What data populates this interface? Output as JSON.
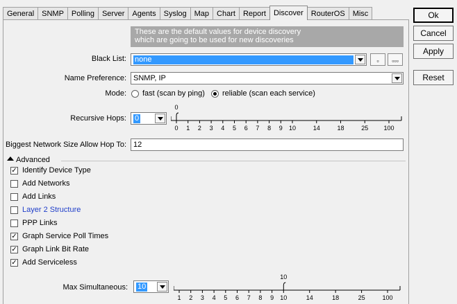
{
  "tabs": [
    "General",
    "SNMP",
    "Polling",
    "Server",
    "Agents",
    "Syslog",
    "Map",
    "Chart",
    "Report",
    "Discover",
    "RouterOS",
    "Misc"
  ],
  "active_tab": "Discover",
  "info": {
    "line1": "These are the default values for device discovery",
    "line2": "which are going to be used for new discoveries"
  },
  "black_list": {
    "label": "Black List:",
    "value": "none",
    "btn1": "▫",
    "btn2": "▫▫▫"
  },
  "name_pref": {
    "label": "Name Preference:",
    "value": "SNMP, IP"
  },
  "mode": {
    "label": "Mode:",
    "options": [
      "fast (scan by ping)",
      "reliable (scan each service)"
    ],
    "selected": "reliable (scan each service)"
  },
  "recursive_hops": {
    "label": "Recursive Hops:",
    "value": "0",
    "slider_value_label": "0",
    "ticks": [
      "0",
      "1",
      "2",
      "3",
      "4",
      "5",
      "6",
      "7",
      "8",
      "9",
      "10",
      "14",
      "18",
      "25",
      "100"
    ],
    "slider_index": 0
  },
  "biggest": {
    "label": "Biggest Network Size Allow Hop To:",
    "value": "12"
  },
  "advanced": {
    "label": "Advanced",
    "items": [
      {
        "label": "Identify Device Type",
        "checked": true
      },
      {
        "label": "Add Networks",
        "checked": false
      },
      {
        "label": "Add Links",
        "checked": false
      },
      {
        "label": "Layer 2 Structure",
        "checked": false,
        "color": "#1f3ec9"
      },
      {
        "label": "PPP Links",
        "checked": false
      },
      {
        "label": "Graph Service Poll Times",
        "checked": true
      },
      {
        "label": "Graph Link Bit Rate",
        "checked": true
      },
      {
        "label": "Add Serviceless",
        "checked": true
      }
    ]
  },
  "max_sim": {
    "label": "Max Simultaneous:",
    "value": "10",
    "slider_value_label": "10",
    "ticks": [
      "1",
      "2",
      "3",
      "4",
      "5",
      "6",
      "7",
      "8",
      "9",
      "10",
      "14",
      "18",
      "25",
      "100"
    ],
    "slider_index": 9
  },
  "buttons": {
    "ok": "Ok",
    "cancel": "Cancel",
    "apply": "Apply",
    "reset": "Reset"
  }
}
